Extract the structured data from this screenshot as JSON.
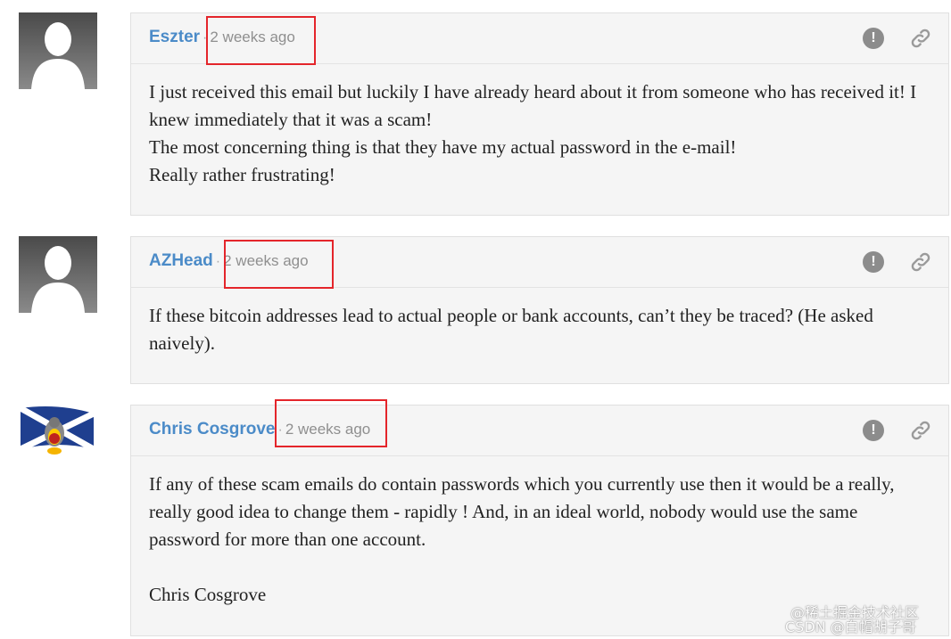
{
  "comments": [
    {
      "author": "Eszter",
      "separator": "·",
      "time": "2 weeks ago",
      "avatar": "default-silhouette",
      "body": [
        "I just received this email but luckily I have already heard about it from someone who has received it! I knew immediately that it was a scam!",
        "The most concerning thing is that they have my actual password in the e-mail!",
        "Really rather frustrating!"
      ]
    },
    {
      "author": "AZHead",
      "separator": "·",
      "time": "2 weeks ago",
      "avatar": "default-silhouette",
      "body": [
        "If these bitcoin addresses lead to actual people or bank accounts, can’t they be traced? (He asked naively)."
      ]
    },
    {
      "author": "Chris Cosgrove",
      "separator": "·",
      "time": "2 weeks ago",
      "avatar": "scottish-flag-penguin",
      "body": [
        "If any of these scam emails do contain passwords which you currently use then it would be a really, really good idea to change them - rapidly ! And, in an ideal world, nobody would use the same password for more than one account.",
        "",
        "Chris Cosgrove"
      ]
    }
  ],
  "icons": {
    "report": "report-flag-icon",
    "link": "permalink-icon",
    "report_glyph": "!"
  },
  "colors": {
    "author": "#4b8bc8",
    "highlight": "#e4252b",
    "icon": "#8c8c8c"
  },
  "watermark": {
    "line1": "@稀土掘金技术社区",
    "line2": "CSDN @白帽胡子哥"
  }
}
